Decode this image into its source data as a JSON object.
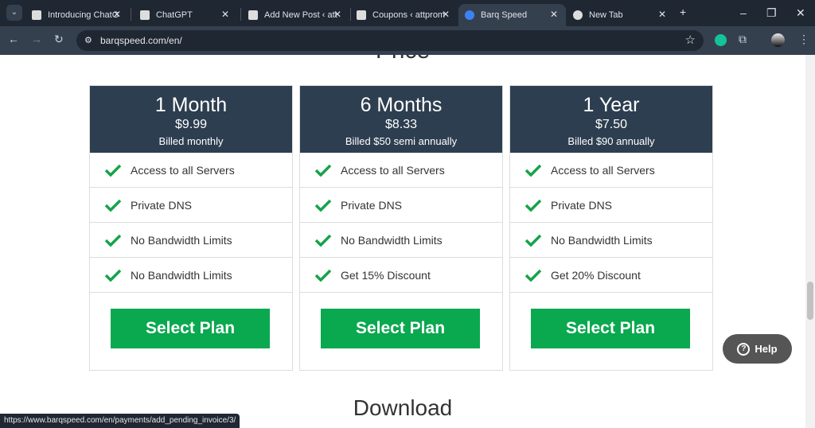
{
  "browser": {
    "tabs": [
      {
        "title": "Introducing ChatG",
        "active": false
      },
      {
        "title": "ChatGPT",
        "active": false
      },
      {
        "title": "Add New Post ‹ att",
        "active": false
      },
      {
        "title": "Coupons ‹ attprom",
        "active": false
      },
      {
        "title": "Barq Speed",
        "active": true
      },
      {
        "title": "New Tab",
        "active": false
      }
    ],
    "url": "barqspeed.com/en/",
    "status_url": "https://www.barqspeed.com/en/payments/add_pending_invoice/3/"
  },
  "page": {
    "section_title": "Price",
    "plans": [
      {
        "name": "1 Month",
        "price": "$9.99",
        "billing": "Billed monthly",
        "features": [
          "Access to all Servers",
          "Private DNS",
          "No Bandwidth Limits",
          "No Bandwidth Limits"
        ],
        "button": "Select Plan"
      },
      {
        "name": "6 Months",
        "price": "$8.33",
        "billing": "Billed $50 semi annually",
        "features": [
          "Access to all Servers",
          "Private DNS",
          "No Bandwidth Limits",
          "Get 15% Discount"
        ],
        "button": "Select Plan"
      },
      {
        "name": "1 Year",
        "price": "$7.50",
        "billing": "Billed $90 annually",
        "features": [
          "Access to all Servers",
          "Private DNS",
          "No Bandwidth Limits",
          "Get 20% Discount"
        ],
        "button": "Select Plan"
      }
    ],
    "next_section_title": "Download",
    "help_label": "Help"
  },
  "colors": {
    "header": "#2d3e50",
    "accent": "#0aa84f",
    "check": "#16a34a"
  }
}
